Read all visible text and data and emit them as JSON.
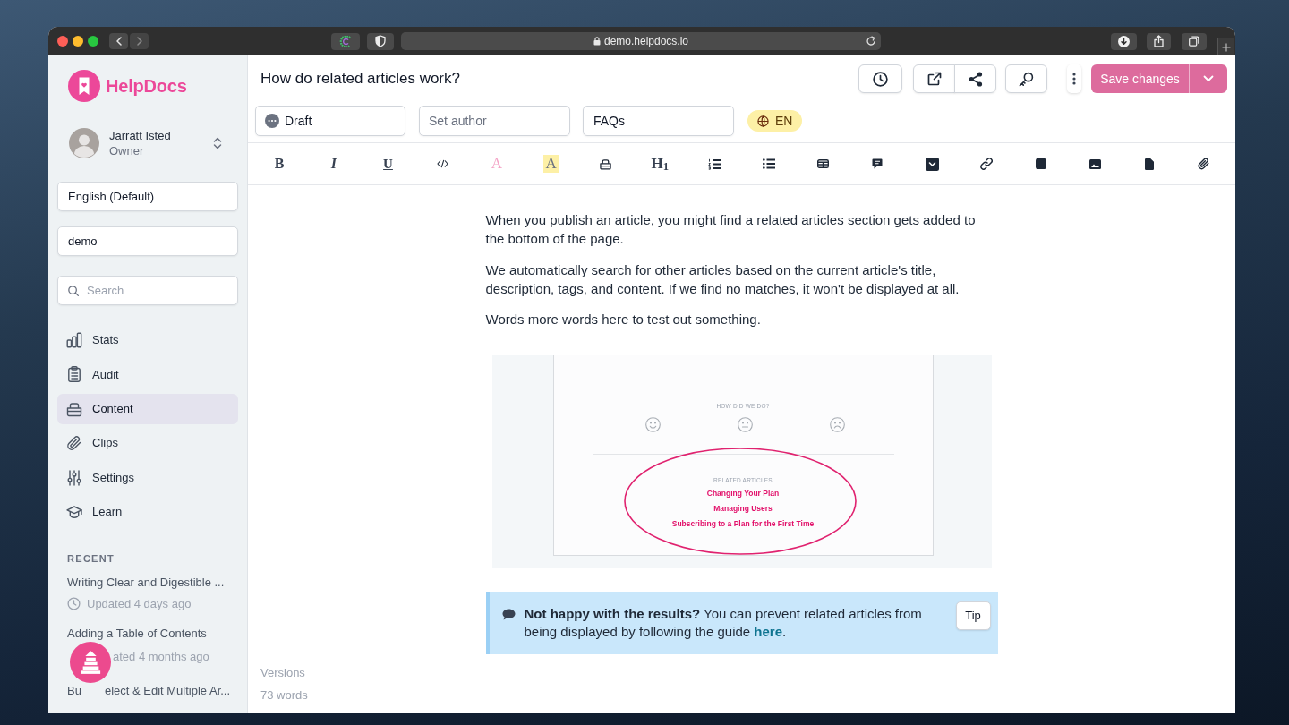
{
  "browser": {
    "url": "demo.helpdocs.io"
  },
  "sidebar": {
    "brand": "HelpDocs",
    "user": {
      "name": "Jarratt Isted",
      "role": "Owner"
    },
    "language": "English (Default)",
    "site": "demo",
    "search": {
      "placeholder": "Search"
    },
    "nav": [
      {
        "label": "Stats",
        "selected": false
      },
      {
        "label": "Audit",
        "selected": false
      },
      {
        "label": "Content",
        "selected": true
      },
      {
        "label": "Clips",
        "selected": false
      },
      {
        "label": "Settings",
        "selected": false
      },
      {
        "label": "Learn",
        "selected": false
      }
    ],
    "recent": {
      "heading": "RECENT",
      "items": [
        {
          "title": "Writing Clear and Digestible ...",
          "updated": "Updated 4 days ago"
        },
        {
          "title": "Adding a Table of Contents",
          "updated": "ated 4 months ago",
          "updated_covered": true
        },
        {
          "title": "Bu",
          "title_tail": "elect & Edit Multiple Ar..."
        }
      ]
    }
  },
  "article": {
    "title": "How do related articles work?",
    "save": {
      "label": "Save changes",
      "disabled": true
    },
    "status": "Draft",
    "author": {
      "placeholder": "Set author"
    },
    "category": "FAQs",
    "language": "EN"
  },
  "toolbar": [
    {
      "kind": "bold",
      "label": "B"
    },
    {
      "kind": "italic",
      "label": "I"
    },
    {
      "kind": "underline",
      "label": "U"
    },
    {
      "kind": "icon"
    },
    {
      "kind": "color",
      "label": "A"
    },
    {
      "kind": "highlight",
      "label": "A"
    },
    {
      "kind": "icon"
    },
    {
      "kind": "heading",
      "label": "H$_{1}$"
    },
    {
      "kind": "icon"
    },
    {
      "kind": "icon"
    },
    {
      "kind": "icon"
    },
    {
      "kind": "icon"
    },
    {
      "kind": "icon"
    },
    {
      "kind": "icon"
    },
    {
      "kind": "icon"
    },
    {
      "kind": "icon"
    },
    {
      "kind": "icon"
    },
    {
      "kind": "icon"
    }
  ],
  "body": {
    "paragraphs": [
      "When you publish an article, you might find a related articles section gets added to the bottom of the page.",
      "We automatically search for other articles based on the current article's title, description, tags, and content. If we find no matches, it won't be displayed at all.",
      "Words more words here to test out something."
    ],
    "figure": {
      "question": "HOW DID WE DO?",
      "related_heading": "RELATED ARTICLES",
      "related": [
        "Changing Your Plan",
        "Managing Users",
        "Subscribing to a Plan for the First Time"
      ]
    },
    "callout": {
      "text": "**Not happy with the results?** You can prevent related articles from being displayed by following the guide ",
      "link": "here",
      "end": ".",
      "label": "Tip"
    }
  },
  "footer": {
    "versions": "Versions",
    "words": "73 words"
  }
}
